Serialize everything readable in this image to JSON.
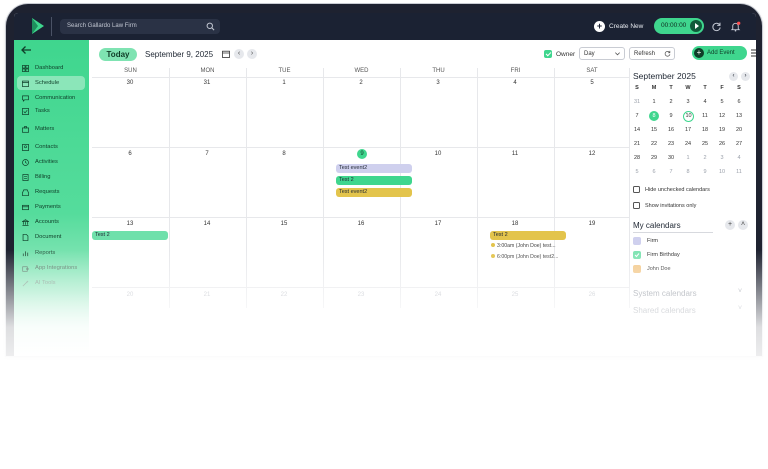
{
  "topbar": {
    "search_placeholder": "Search Gallardo Law Firm",
    "create_new": "Create New",
    "timer": "00:00:00"
  },
  "sidebar": {
    "items": [
      {
        "label": "Dashboard"
      },
      {
        "label": "Schedule"
      },
      {
        "label": "Communication"
      },
      {
        "label": "Tasks"
      },
      {
        "label": "Matters"
      },
      {
        "label": "Contacts"
      },
      {
        "label": "Activities"
      },
      {
        "label": "Billing"
      },
      {
        "label": "Requests"
      },
      {
        "label": "Payments"
      },
      {
        "label": "Accounts"
      },
      {
        "label": "Document"
      },
      {
        "label": "Reports"
      },
      {
        "label": "App Integrations"
      },
      {
        "label": "AI Tools"
      }
    ]
  },
  "header": {
    "today": "Today",
    "date": "September 9, 2025",
    "owner": "Owner",
    "view": "Day",
    "refresh": "Refresh",
    "add_event": "Add Event"
  },
  "calendar": {
    "weekdays": [
      "SUN",
      "MON",
      "TUE",
      "WED",
      "THU",
      "FRI",
      "SAT"
    ],
    "weeks": [
      [
        "30",
        "31",
        "1",
        "2",
        "3",
        "4",
        "5"
      ],
      [
        "6",
        "7",
        "8",
        "9",
        "10",
        "11",
        "12"
      ],
      [
        "13",
        "14",
        "15",
        "16",
        "17",
        "18",
        "19"
      ],
      [
        "20",
        "21",
        "22",
        "23",
        "24",
        "25",
        "26"
      ]
    ],
    "events": {
      "wed9_1": "Test event2",
      "wed9_2": "Test 2",
      "wed9_3": "Test event2",
      "sun13": "Test 2",
      "fri18": "Test 2",
      "fri18_line1": "3:00am (John Doe) test...",
      "fri18_line2": "6:00pm (John Doe) test2..."
    },
    "colors": {
      "lavender": "#cfd0ee",
      "green": "#3fd68e",
      "mint": "#6fe0ab",
      "gold": "#e3c44c",
      "accent": "#3fd68e"
    }
  },
  "mini": {
    "title": "September 2025",
    "weekdays": [
      "S",
      "M",
      "T",
      "W",
      "T",
      "F",
      "S"
    ],
    "rows": [
      [
        "31",
        "1",
        "2",
        "3",
        "4",
        "5",
        "6"
      ],
      [
        "7",
        "8",
        "9",
        "10",
        "11",
        "12",
        "13"
      ],
      [
        "14",
        "15",
        "16",
        "17",
        "18",
        "19",
        "20"
      ],
      [
        "21",
        "22",
        "23",
        "24",
        "25",
        "26",
        "27"
      ],
      [
        "28",
        "29",
        "30",
        "1",
        "2",
        "3",
        "4"
      ],
      [
        "5",
        "6",
        "7",
        "8",
        "9",
        "10",
        "11"
      ]
    ]
  },
  "rpanel": {
    "hide_unchecked": "Hide unchecked calendars",
    "show_invitations": "Show invitations only",
    "my_calendars": "My calendars",
    "calendars": [
      {
        "label": "Firm",
        "color": "#cfd0ee"
      },
      {
        "label": "Firm Birthday",
        "color": "#7fe3b2"
      },
      {
        "label": "John Doe",
        "color": "#f3c98b"
      }
    ],
    "system_calendars": "System calendars",
    "shared_calendars": "Shared calendars"
  }
}
